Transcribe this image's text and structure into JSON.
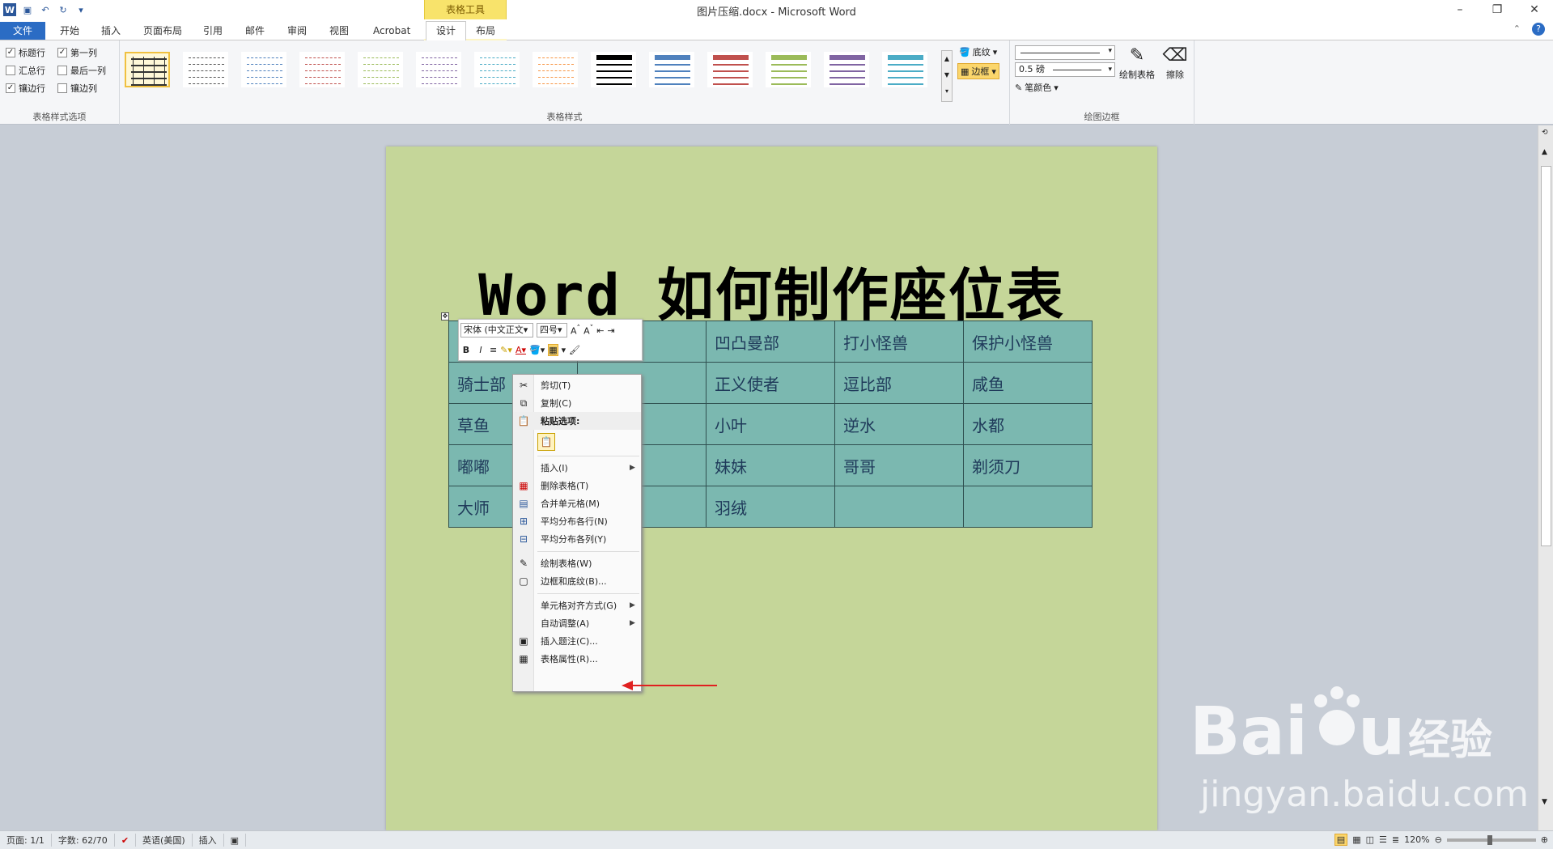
{
  "window": {
    "title": "图片压缩.docx - Microsoft Word",
    "minimize": "–",
    "restore": "❐",
    "close": "✕"
  },
  "tabs": {
    "file": "文件",
    "home": "开始",
    "insert": "插入",
    "layout": "页面布局",
    "references": "引用",
    "mailings": "邮件",
    "review": "审阅",
    "view": "视图",
    "acrobat": "Acrobat",
    "context_header": "表格工具",
    "design": "设计",
    "table_layout": "布局"
  },
  "ribbon": {
    "options": {
      "header_row": "标题行",
      "first_column": "第一列",
      "total_row": "汇总行",
      "last_column": "最后一列",
      "banded_rows": "镶边行",
      "banded_columns": "镶边列",
      "group_label": "表格样式选项"
    },
    "styles_label": "表格样式",
    "shading": "底纹",
    "borders": "边框",
    "pen_weight": "0.5 磅",
    "pen_color": "笔颜色",
    "draw_table": "绘制表格",
    "eraser": "擦除",
    "draw_borders_label": "绘图边框",
    "style_colors": [
      "#333333",
      "#555555",
      "#4f81bd",
      "#c0504d",
      "#9bbb59",
      "#8064a2",
      "#4bacc6",
      "#f79646",
      "#000000",
      "#4f81bd",
      "#c0504d",
      "#9bbb59",
      "#8064a2",
      "#4bacc6"
    ]
  },
  "document": {
    "title": "Word 如何制作座位表",
    "table": [
      [
        "",
        "",
        "凹凸曼部",
        "打小怪兽",
        "保护小怪兽"
      ],
      [
        "骑士部",
        "",
        "正义使者",
        "逗比部",
        "咸鱼"
      ],
      [
        "草鱼",
        "",
        "小叶",
        "逆水",
        "水都"
      ],
      [
        "嘟嘟",
        "",
        "妹妹",
        "哥哥",
        "剃须刀"
      ],
      [
        "大师",
        "",
        "羽绒",
        "",
        ""
      ]
    ]
  },
  "mini_toolbar": {
    "font": "宋体 (中文正文",
    "size": "四号",
    "bold": "B",
    "italic": "I"
  },
  "context_menu": {
    "cut": "剪切(T)",
    "copy": "复制(C)",
    "paste_options": "粘贴选项:",
    "insert": "插入(I)",
    "delete_table": "删除表格(T)",
    "merge_cells": "合并单元格(M)",
    "distribute_rows": "平均分布各行(N)",
    "distribute_columns": "平均分布各列(Y)",
    "draw_table": "绘制表格(W)",
    "borders_shading": "边框和底纹(B)...",
    "cell_alignment": "单元格对齐方式(G)",
    "autofit": "自动调整(A)",
    "insert_caption": "插入题注(C)...",
    "table_properties": "表格属性(R)..."
  },
  "statusbar": {
    "page": "页面: 1/1",
    "words": "字数: 62/70",
    "language": "英语(美国)",
    "mode": "插入",
    "zoom": "120%"
  },
  "watermark": {
    "logo": "Bai du 经验",
    "url": "jingyan.baidu.com"
  }
}
